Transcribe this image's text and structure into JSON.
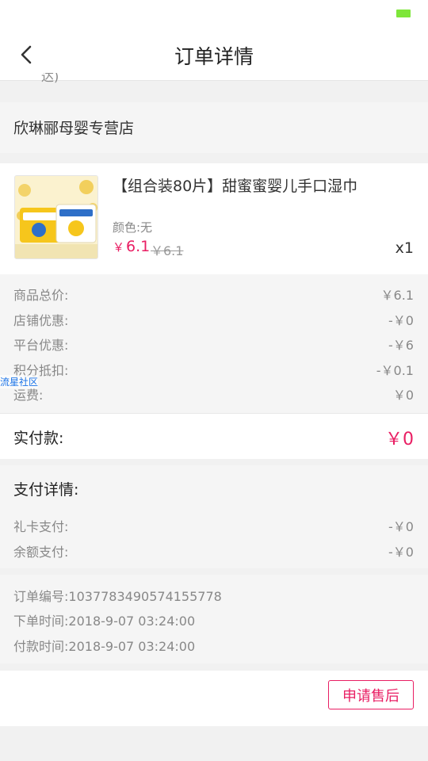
{
  "nav": {
    "title": "订单详情"
  },
  "cut_text": "达)",
  "shop": {
    "name": "欣琳郦母婴专营店"
  },
  "product": {
    "title": "【组合装80片】甜蜜蜜婴儿手口湿巾",
    "color": "颜色:无",
    "currency": "￥",
    "price": "6.1",
    "original_price": "￥6.1",
    "quantity": "x1"
  },
  "summary": [
    {
      "label": "商品总价:",
      "value": "￥6.1"
    },
    {
      "label": "店铺优惠:",
      "value": "-￥0"
    },
    {
      "label": "平台优惠:",
      "value": "-￥6"
    },
    {
      "label": "积分抵扣:",
      "value": "-￥0.1"
    },
    {
      "label": "运费:",
      "value": "￥0"
    }
  ],
  "watermark": "流星社区",
  "paid": {
    "label": "实付款:",
    "value": "￥0"
  },
  "pay_detail": {
    "title": "支付详情:",
    "rows": [
      {
        "label": "礼卡支付:",
        "value": "-￥0"
      },
      {
        "label": "余额支付:",
        "value": "-￥0"
      }
    ]
  },
  "order_info": [
    {
      "label": "订单编号:",
      "value": "1037783490574155778"
    },
    {
      "label": "下单时间:",
      "value": "2018-9-07 03:24:00"
    },
    {
      "label": "付款时间:",
      "value": "2018-9-07 03:24:00"
    }
  ],
  "actions": {
    "after_sale": "申请售后"
  },
  "icons": {
    "back": "chevron-left-icon",
    "battery": "battery-icon"
  },
  "colors": {
    "accent": "#e91e63",
    "battery": "#7ee63a"
  }
}
